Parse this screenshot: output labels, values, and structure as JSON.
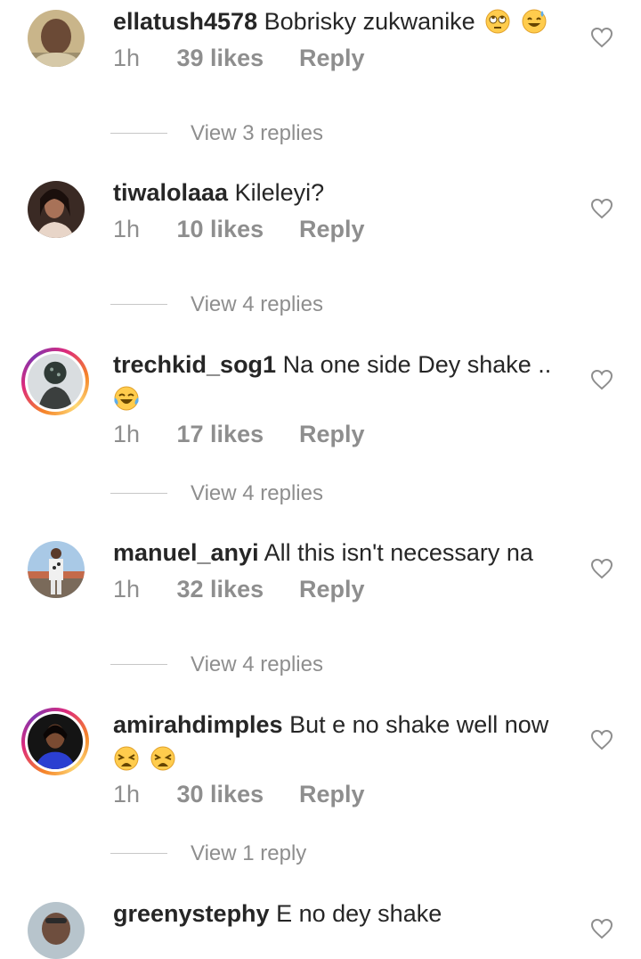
{
  "comments": [
    {
      "username": "ellatush4578",
      "text": "Bobrisky zukwanike",
      "time": "1h",
      "likes": "39 likes",
      "reply": "Reply",
      "replies_label": "View 3 replies",
      "emojis": [
        "face-with-rolling-eyes-emoji",
        "grinning-sweat-emoji"
      ]
    },
    {
      "username": "tiwalolaaa",
      "text": "Kileleyi?",
      "time": "1h",
      "likes": "10 likes",
      "reply": "Reply",
      "replies_label": "View 4 replies",
      "emojis": []
    },
    {
      "username": "trechkid_sog1",
      "text": "Na one side Dey shake ..",
      "time": "1h",
      "likes": "17 likes",
      "reply": "Reply",
      "replies_label": "View 4 replies",
      "emojis": [
        "tears-of-joy-emoji"
      ]
    },
    {
      "username": "manuel_anyi",
      "text": "All this isn't necessary na",
      "time": "1h",
      "likes": "32 likes",
      "reply": "Reply",
      "replies_label": "View 4 replies",
      "emojis": []
    },
    {
      "username": "amirahdimples",
      "text": "But e no shake well now",
      "time": "1h",
      "likes": "30 likes",
      "reply": "Reply",
      "replies_label": "View 1 reply",
      "emojis": [
        "weary-face-emoji",
        "weary-face-emoji"
      ]
    },
    {
      "username": "greenystephy",
      "text": "E no dey shake",
      "emojis": []
    }
  ],
  "colors": {
    "text": "#262626",
    "secondary": "#8e8e8e",
    "story_ring": "#dd2a7b"
  }
}
